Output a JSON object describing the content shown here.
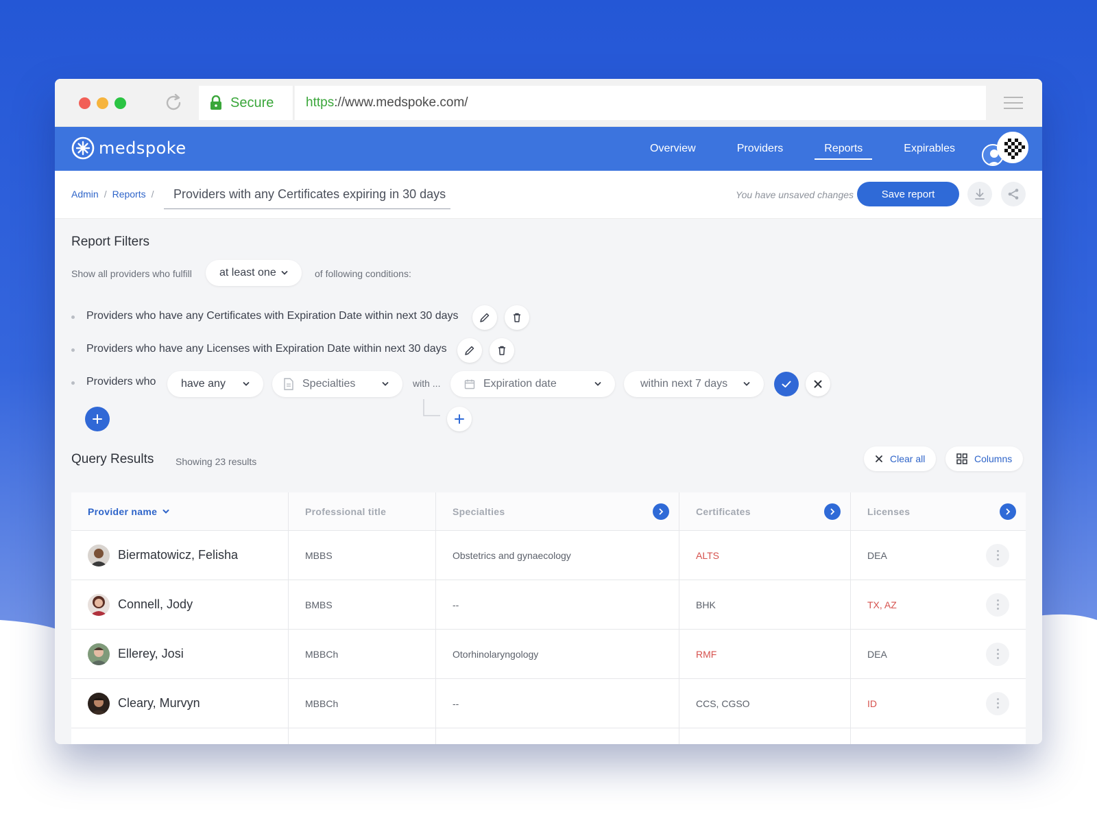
{
  "browser": {
    "secure_label": "Secure",
    "url_scheme": "https",
    "url_rest": "://www.medspoke.com/"
  },
  "app": {
    "brand": "medspoke",
    "nav": [
      {
        "label": "Overview",
        "active": false
      },
      {
        "label": "Providers",
        "active": false
      },
      {
        "label": "Reports",
        "active": true
      },
      {
        "label": "Expirables",
        "active": false
      }
    ]
  },
  "breadcrumb": {
    "items": [
      "Admin",
      "Reports"
    ],
    "separator": "/",
    "report_title": "Providers with any Certificates expiring in 30 days"
  },
  "actions": {
    "unsaved": "You have unsaved changes",
    "save_label": "Save report"
  },
  "filters": {
    "title": "Report Filters",
    "intro_prefix": "Show all providers who fulfill",
    "match_mode": "at least one",
    "intro_suffix": "of following conditions:",
    "conditions": [
      "Providers who have any Certificates with Expiration Date within next 30 days",
      "Providers who have any Licenses with Expiration Date within next 30 days"
    ],
    "builder": {
      "prefix": "Providers who",
      "quantifier": "have any",
      "entity": "Specialties",
      "with_label": "with ...",
      "field": "Expiration date",
      "range": "within next 7 days"
    }
  },
  "results": {
    "title": "Query Results",
    "count_text": "Showing 23 results",
    "clear_label": "Clear all",
    "columns_label": "Columns",
    "headers": [
      "Provider name",
      "Professional title",
      "Specialties",
      "Certificates",
      "Licenses"
    ],
    "rows": [
      {
        "name": "Biermatowicz, Felisha",
        "title": "MBBS",
        "specialty": "Obstetrics and gynaecology",
        "certificates": "ALTS",
        "cert_flag": true,
        "licenses": "DEA",
        "lic_flag": false
      },
      {
        "name": "Connell, Jody",
        "title": "BMBS",
        "specialty": "--",
        "certificates": "BHK",
        "cert_flag": false,
        "licenses": "TX, AZ",
        "lic_flag": true
      },
      {
        "name": "Ellerey, Josi",
        "title": "MBBCh",
        "specialty": "Otorhinolaryngology",
        "certificates": "RMF",
        "cert_flag": true,
        "licenses": "DEA",
        "lic_flag": false
      },
      {
        "name": "Cleary, Murvyn",
        "title": "MBBCh",
        "specialty": "--",
        "certificates": "CCS, CGSO",
        "cert_flag": false,
        "licenses": "ID",
        "lic_flag": true
      }
    ]
  },
  "colors": {
    "brand": "#3c74de",
    "primary": "#2f6ad7",
    "alert": "#d6514d",
    "secure": "#3aa63a"
  }
}
